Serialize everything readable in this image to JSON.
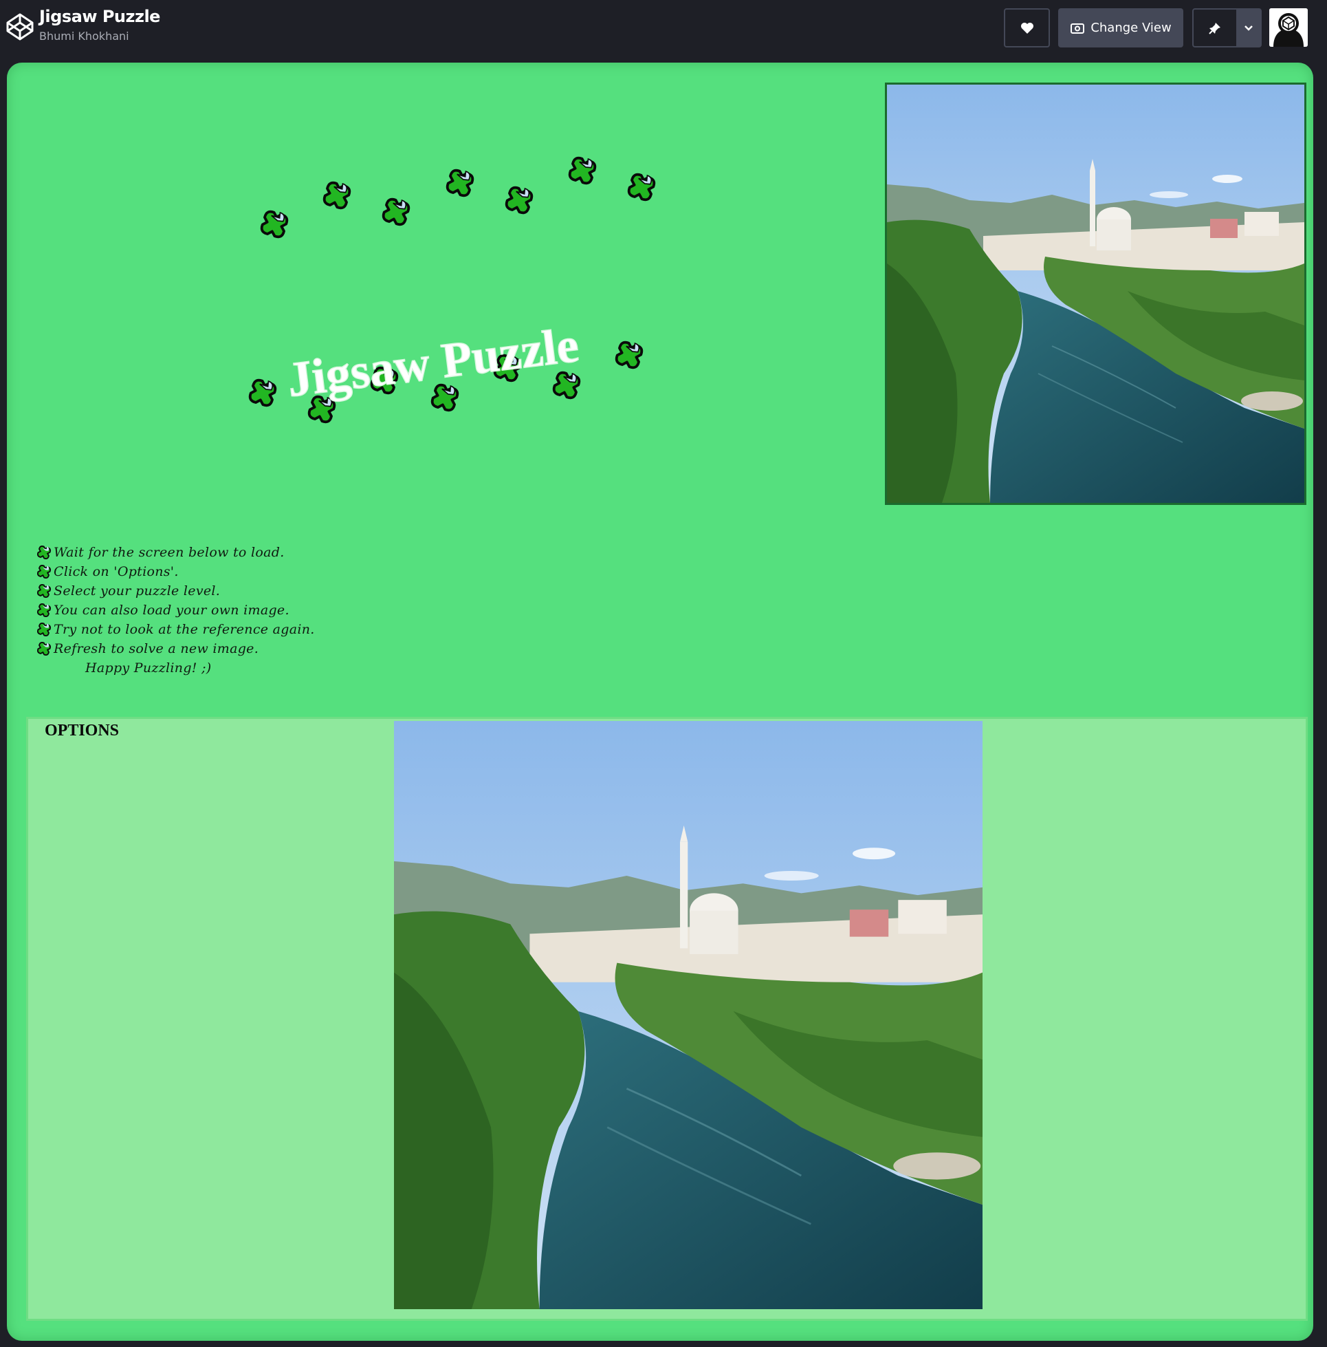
{
  "header": {
    "title": "Jigsaw Puzzle",
    "author": "Bhumi Khokhani",
    "change_view_label": "Change View"
  },
  "banner": {
    "title": "Jigsaw Puzzle"
  },
  "instructions": [
    "Wait for the screen below to load.",
    "Click on 'Options'.",
    "Select your puzzle level.",
    "You can also load your own image.",
    "Try not to look at the reference again.",
    "Refresh to solve a new image."
  ],
  "closing": "Happy Puzzling! ;)",
  "options": {
    "label": "OPTIONS"
  },
  "colors": {
    "header_bg": "#1e1f26",
    "panel_green": "#55e07e",
    "options_green": "#8fe89d",
    "piece_green": "#22b622"
  }
}
